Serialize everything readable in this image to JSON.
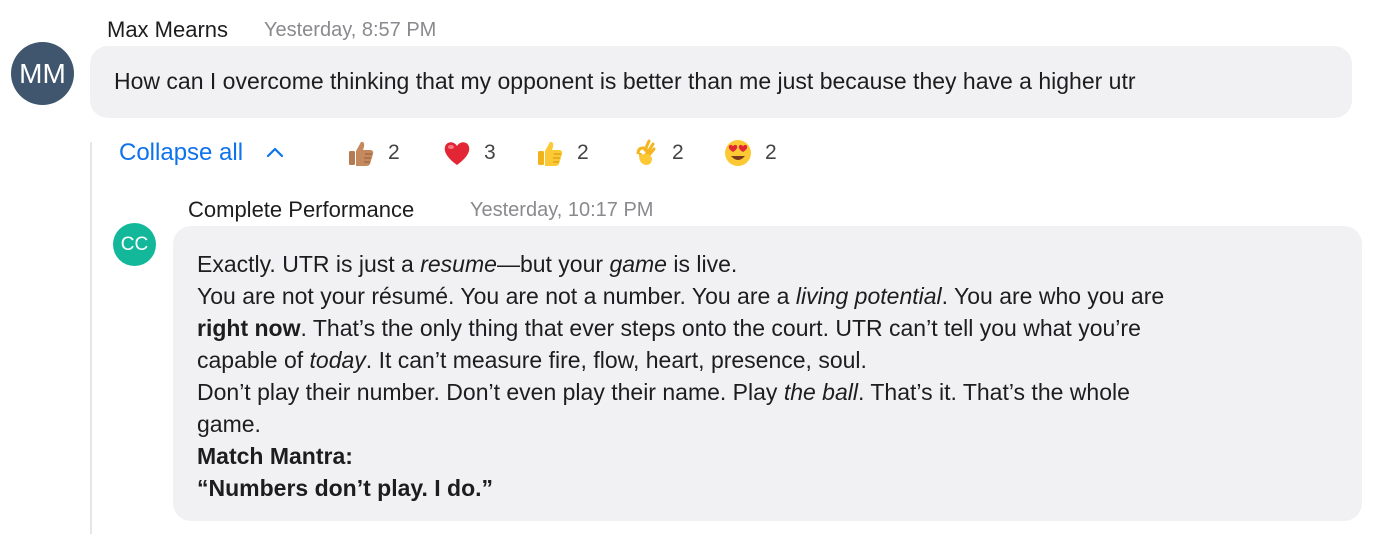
{
  "question": {
    "sender": "Max Mearns",
    "time": "Yesterday, 8:57 PM",
    "avatar_initials": "MM",
    "avatar_color": "#3f566e",
    "text": "How can I overcome thinking that my opponent is better than me just because they have a higher utr"
  },
  "thread": {
    "collapse_label": "Collapse all",
    "collapse_icon": "chevron-up-icon",
    "reactions": [
      {
        "emoji": "thumbs-up-medium-skin",
        "count": "2"
      },
      {
        "emoji": "red-heart",
        "count": "3"
      },
      {
        "emoji": "thumbs-up",
        "count": "2"
      },
      {
        "emoji": "ok-hand",
        "count": "2"
      },
      {
        "emoji": "heart-eyes",
        "count": "2"
      }
    ]
  },
  "reply": {
    "sender": "Complete Performance",
    "time": "Yesterday, 10:17 PM",
    "avatar_initials": "CC",
    "avatar_color": "#13b89a",
    "lines": [
      {
        "a": "Exactly. UTR is just a ",
        "b": "resume",
        "c": "—but your ",
        "d": "game",
        "e": " is live."
      },
      {
        "a": "You are not your résumé. You are not a number. You are a ",
        "b": "living potential",
        "c": ". You are who you are"
      },
      {
        "a": "right now",
        "b": ". That’s the only thing that ever steps onto the court. UTR can’t tell you what you’re"
      },
      {
        "a": "capable of ",
        "b": "today",
        "c": ". It can’t measure fire, flow, heart, presence, soul."
      },
      {
        "a": "Don’t play their number. Don’t even play their name. Play ",
        "b": "the ball",
        "c": ". That’s it. That’s the whole"
      },
      {
        "a": "game."
      },
      {
        "a": "Match Mantra:"
      },
      {
        "a": "“Numbers don’t play. I do.”"
      }
    ]
  },
  "colors": {
    "accent": "#0e72ed",
    "bubble": "#f1f1f4",
    "timestamp": "#8a8a8e"
  }
}
